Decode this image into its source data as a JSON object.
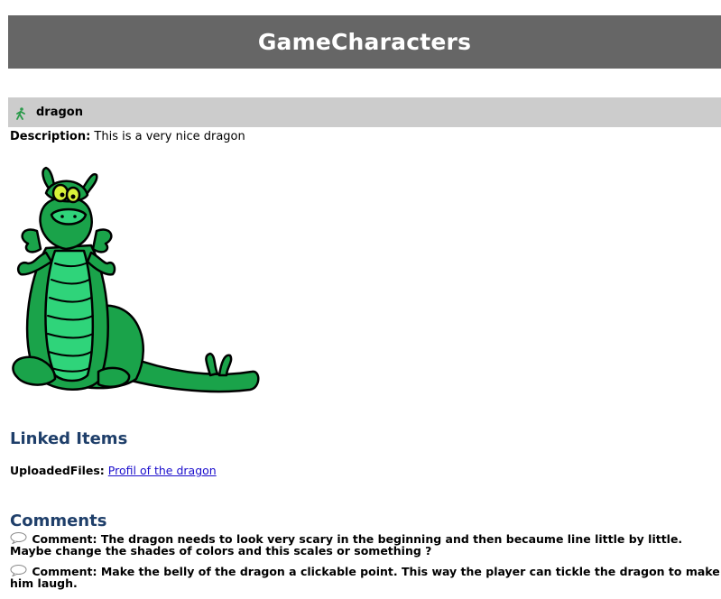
{
  "page": {
    "title": "GameCharacters"
  },
  "item": {
    "icon": "walking-figure-icon",
    "name": "dragon",
    "description_label": "Description:",
    "description": "This is a very nice dragon",
    "image_alt": "dragon"
  },
  "linked_items": {
    "heading": "Linked Items",
    "uploaded_label": "UploadedFiles:",
    "uploaded_link": "Profil of the dragon"
  },
  "comments": {
    "heading": "Comments",
    "icon": "speech-bubble-icon",
    "items": [
      {
        "text": "Comment: The dragon needs to look very scary in the beginning and then becaume line little by little. Maybe change the shades of colors and this scales or something ?"
      },
      {
        "text": "Comment: Make the belly of the dragon a clickable point. This way the player can tickle the dragon to make him laugh."
      }
    ]
  },
  "colors": {
    "title_bar": "#666666",
    "item_header": "#cccccc",
    "heading_blue": "#1f3f6a",
    "link_blue": "#1a0dcc",
    "dragon_green": "#1aa34a",
    "dragon_light": "#2fd47a"
  }
}
